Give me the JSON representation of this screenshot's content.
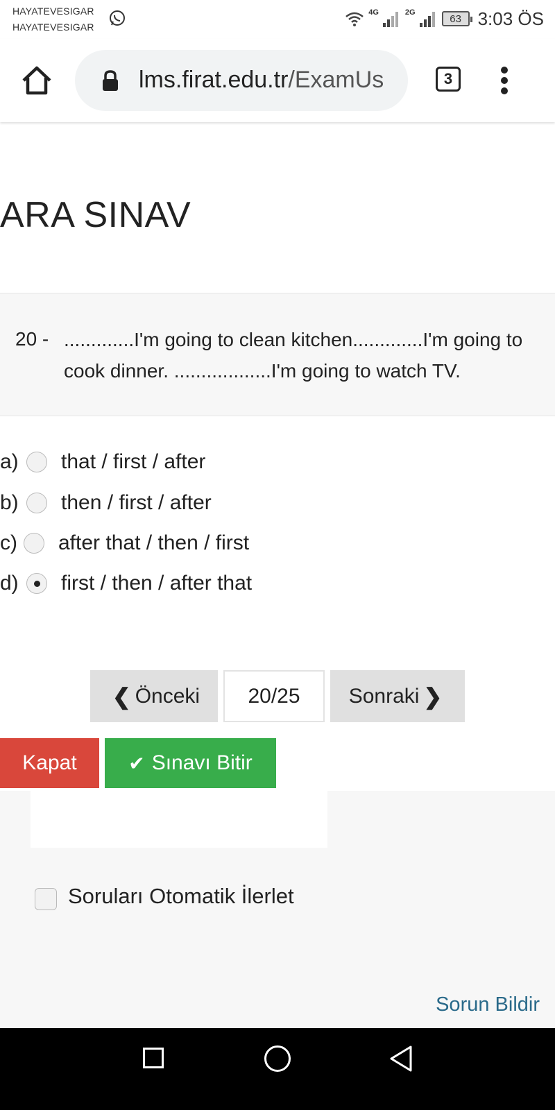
{
  "status_bar": {
    "carrier_line1": "HAYATEVESIGAR",
    "carrier_line2": "HAYATEVESIGAR",
    "network_4g": "4G",
    "network_2g": "2G",
    "battery": "63",
    "time": "3:03 ÖS"
  },
  "browser": {
    "url_domain": "lms.firat.edu.tr",
    "url_path": "/ExamUs",
    "tab_count": "3"
  },
  "page": {
    "title": "ARA SINAV"
  },
  "question": {
    "number": "20 -",
    "text": ".............I'm going to clean kitchen.............I'm going to cook dinner. ..................I'm going to watch TV.",
    "options": [
      {
        "letter": "a)",
        "text": "that / first / after",
        "selected": false
      },
      {
        "letter": "b)",
        "text": "then / first / after",
        "selected": false
      },
      {
        "letter": "c)",
        "text": "after that / then / first",
        "selected": false
      },
      {
        "letter": "d)",
        "text": "first / then / after that",
        "selected": true
      }
    ]
  },
  "pagination": {
    "prev_label": "Önceki",
    "counter": "20/25",
    "next_label": "Sonraki"
  },
  "actions": {
    "close_label": "Kapat",
    "finish_label": "Sınavı Bitir"
  },
  "settings": {
    "auto_advance_label": "Soruları Otomatik İlerlet"
  },
  "footer": {
    "report_label": "Sorun Bildir"
  },
  "colors": {
    "close_button": "#d9473b",
    "finish_button": "#38ad4b",
    "link": "#2a6a8a"
  }
}
